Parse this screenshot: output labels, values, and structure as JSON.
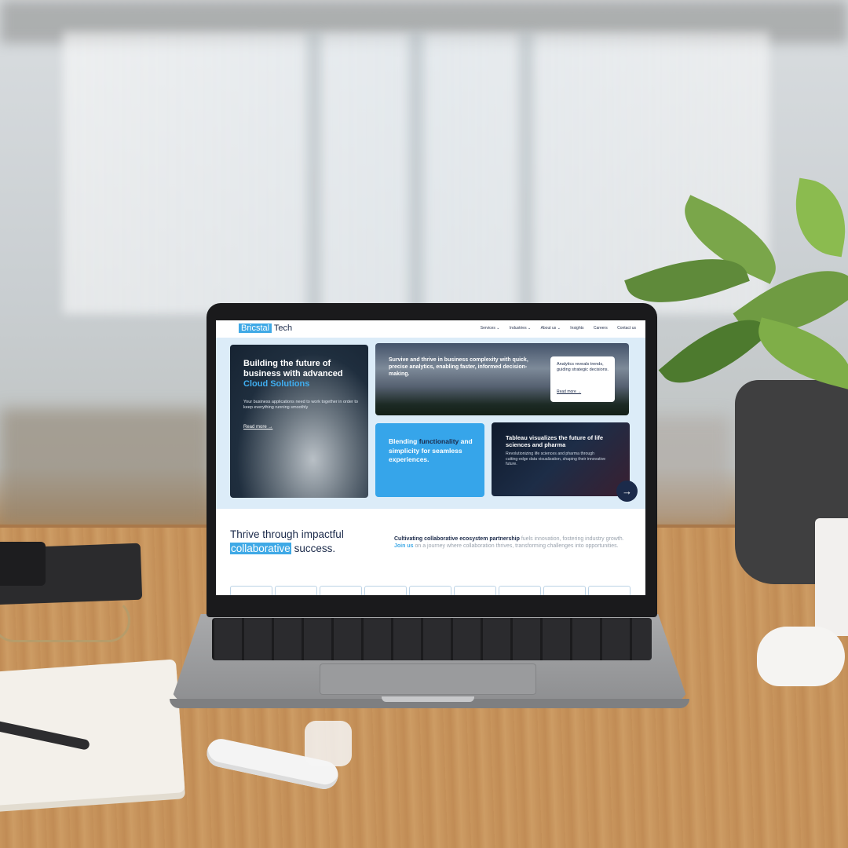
{
  "site": {
    "logo_part1": "Bricstal",
    "logo_part2": "Tech",
    "nav": [
      "Services ⌄",
      "Industries ⌄",
      "About us ⌄",
      "Insights",
      "Careers",
      "Contact us"
    ]
  },
  "hero": {
    "card1": {
      "title_line": "Building the future of business with advanced",
      "title_highlight": "Cloud Solutions",
      "body": "Your business applications need to work together in order to keep everything running smoothly",
      "link": "Read more →"
    },
    "card2": {
      "title": "Survive and thrive in business complexity with quick, precise analytics, enabling faster, informed decision-making.",
      "popup_text": "Analytics reveals trends, guiding strategic decisions.",
      "popup_link": "Read more →"
    },
    "card3": {
      "text_a": "Blending",
      "text_highlight": "functionality",
      "text_b": "and simplicity for seamless experiences."
    },
    "card4": {
      "title": "Tableau visualizes the future of life sciences and pharma",
      "body": "Revolutionizing life sciences and pharma through cutting-edge data visualization, shaping their innovative future."
    },
    "next_arrow": "→"
  },
  "section2": {
    "title_a": "Thrive through impactful",
    "title_highlight": "collaborative",
    "title_b": "success.",
    "text_bold": "Cultivating collaborative ecosystem partnership",
    "text_a": "fuels innovation, fostering industry growth.",
    "text_join": "Join us",
    "text_b": "on a journey where collaboration thrives, transforming challenges into opportunities."
  },
  "colors": {
    "accent": "#3fa9e6",
    "navy": "#1b2a4a"
  }
}
